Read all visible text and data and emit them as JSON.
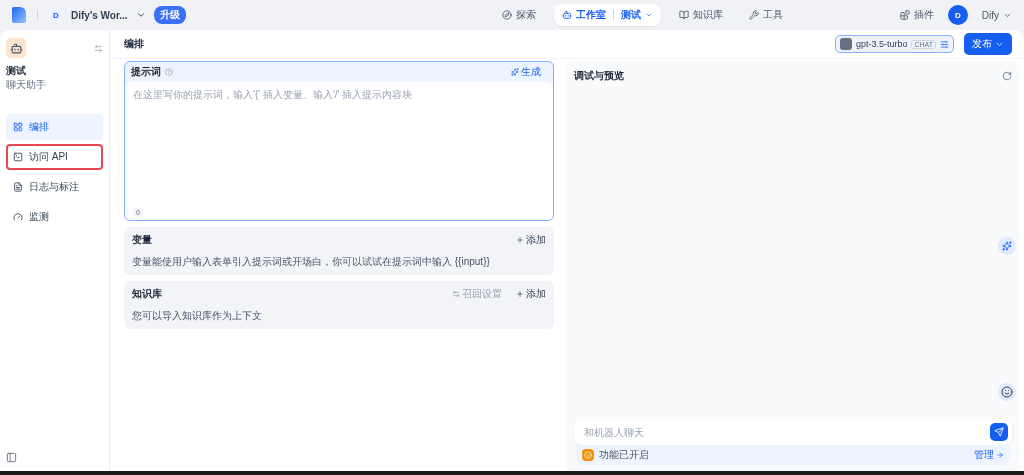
{
  "topbar": {
    "workspace_initial": "D",
    "workspace": "Dify's Wor...",
    "upgrade": "升级",
    "nav": [
      {
        "label": "探索",
        "kind": "explore",
        "selected": false
      },
      {
        "label": "工作室",
        "kind": "studio",
        "selected": true,
        "app": "测试"
      },
      {
        "label": "知识库",
        "kind": "knowledge",
        "selected": false
      },
      {
        "label": "工具",
        "kind": "tools",
        "selected": false
      }
    ],
    "plugins": "插件",
    "user_initial": "D",
    "user": "Dify"
  },
  "sidebar": {
    "app_name": "测试",
    "app_type": "聊天助手",
    "items": [
      {
        "label": "编排",
        "kind": "orchestrate",
        "selected": true,
        "highlighted": false
      },
      {
        "label": "访问 API",
        "kind": "api",
        "selected": false,
        "highlighted": true
      },
      {
        "label": "日志与标注",
        "kind": "logs",
        "selected": false,
        "highlighted": false
      },
      {
        "label": "监测",
        "kind": "monitor",
        "selected": false,
        "highlighted": false
      }
    ]
  },
  "header": {
    "title": "编排",
    "model": "gpt-3.5-turbo",
    "model_tag": "CHAT",
    "publish": "发布"
  },
  "prompt": {
    "title": "提示词",
    "generate": "生成",
    "placeholder": "在这里写你的提示词，输入'{' 插入变量、输入'/' 插入提示内容块",
    "count": "0"
  },
  "variables": {
    "title": "变量",
    "add": "添加",
    "description": "变量能使用户输入表单引入提示词或开场白，你可以试试在提示词中输入 {{input}}"
  },
  "knowledge": {
    "title": "知识库",
    "recall": "召回设置",
    "add": "添加",
    "description": "您可以导入知识库作为上下文"
  },
  "preview": {
    "title": "调试与预览",
    "chat_placeholder": "和机器人聊天",
    "feature_status": "功能已开启",
    "manage": "管理"
  }
}
